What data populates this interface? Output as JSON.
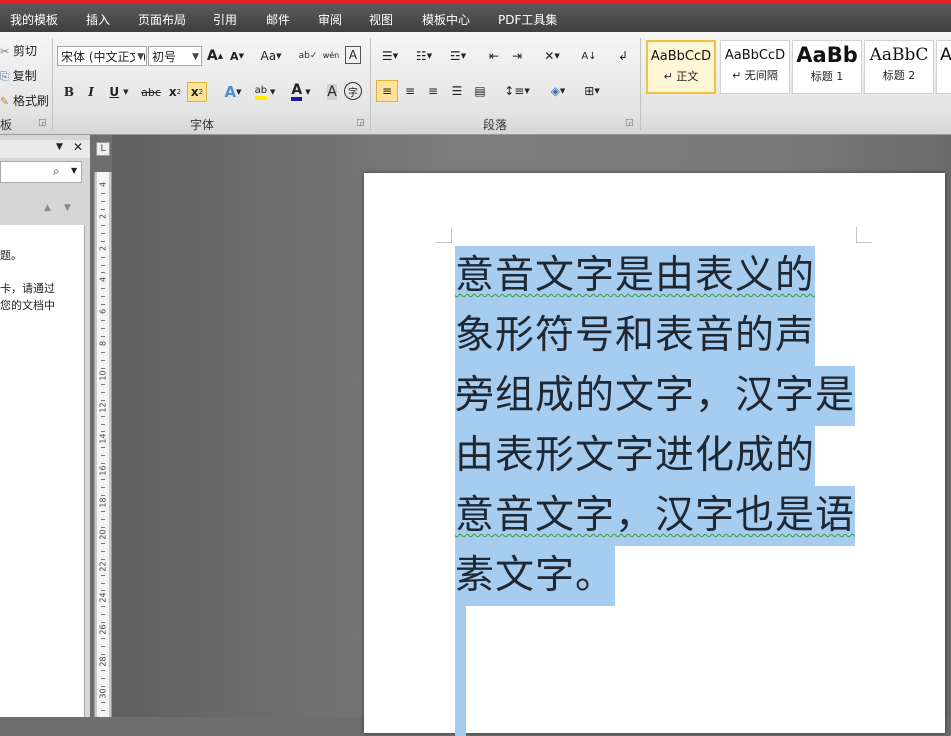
{
  "menu": {
    "tabs": [
      "我的模板",
      "插入",
      "页面布局",
      "引用",
      "邮件",
      "审阅",
      "视图",
      "模板中心",
      "PDF工具集"
    ]
  },
  "clipboard": {
    "cut_label": "剪切",
    "copy_label": "复制",
    "format_painter_label": "格式刷",
    "group_label_partial": "板"
  },
  "font": {
    "font_name_value": "宋体 (中文正文)",
    "font_size_value": "初号",
    "group_label": "字体",
    "grow_glyph": "A",
    "shrink_glyph": "A",
    "change_case_glyph": "Aa",
    "bold_glyph": "B",
    "italic_glyph": "I",
    "underline_glyph": "U",
    "strike_glyph": "abc",
    "subscript_glyph": "x",
    "superscript_glyph": "x",
    "text_effect_glyph": "A",
    "highlight_glyph": "ab",
    "font_color_glyph": "A",
    "char_shading_glyph": "A",
    "enclose_glyph": "字",
    "phonetic_glyph": "wén",
    "char_border_glyph": "A"
  },
  "paragraph": {
    "group_label": "段落"
  },
  "styles": [
    {
      "sample": "AaBbCcD",
      "name": "↵ 正文",
      "selected": true
    },
    {
      "sample": "AaBbCcD",
      "name": "↵ 无间隔",
      "selected": false
    },
    {
      "sample": "AaBb",
      "name": "标题 1",
      "selected": false
    },
    {
      "sample": "AaBbC",
      "name": "标题 2",
      "selected": false
    },
    {
      "sample": "A",
      "name": "",
      "selected": false
    }
  ],
  "nav_panel": {
    "text_line1": "题。",
    "text_line2": "卡，请通过",
    "text_line3": "您的文档中"
  },
  "ruler": {
    "box_glyph": "L",
    "numbers": [
      "4",
      "2",
      "2",
      "4",
      "6",
      "8",
      "10",
      "12",
      "14",
      "16",
      "18",
      "20",
      "22",
      "24",
      "26",
      "28",
      "30"
    ]
  },
  "document": {
    "lines": [
      " 意音文字是由表义的",
      "象形符号和表音的声",
      "旁组成的文字，汉字是",
      "由表形文字进化成的",
      "意音文字，汉字也是语",
      "素文字。"
    ]
  },
  "colors": {
    "selection": "#a6cdef",
    "title_bar_red": "#e31f24",
    "style_selected_border": "#f0c040"
  }
}
